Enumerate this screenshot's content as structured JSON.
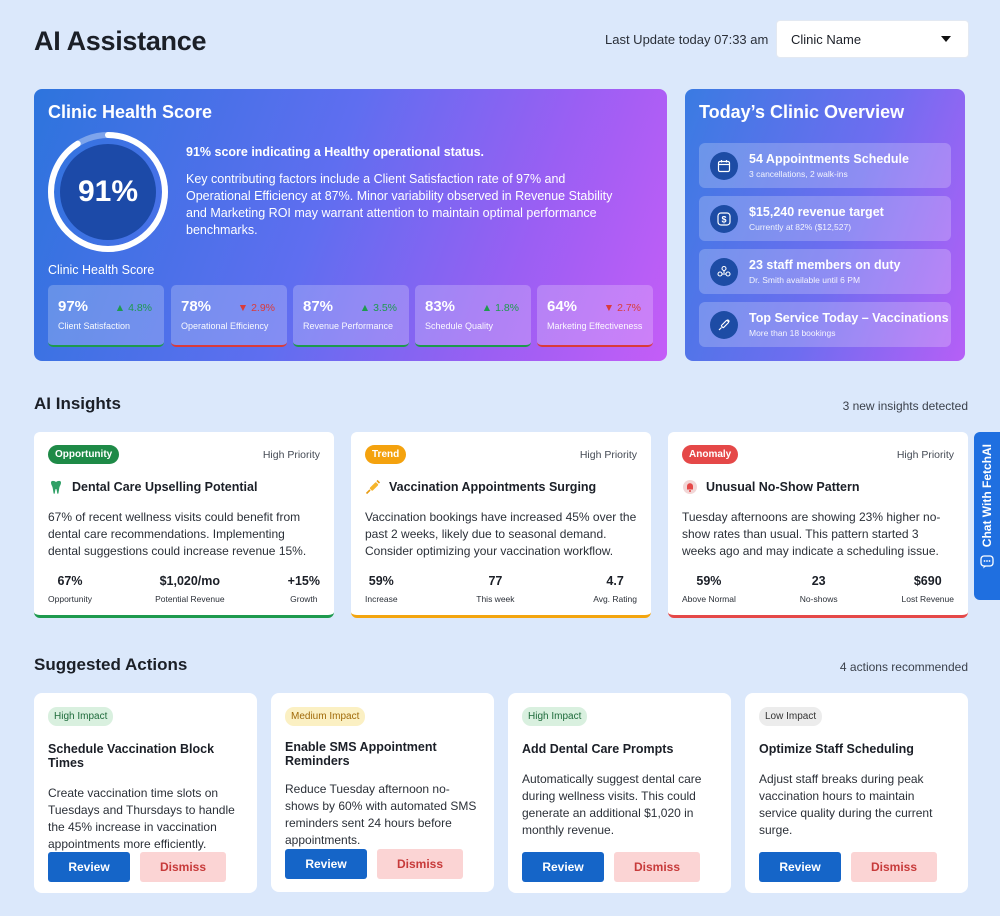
{
  "header": {
    "title": "AI Assistance",
    "last_update": "Last Update today 07:33 am",
    "clinic_select": "Clinic Name"
  },
  "health": {
    "title": "Clinic Health Score",
    "score": "91%",
    "score_fraction": 0.91,
    "headline": "91% score indicating a Healthy operational status.",
    "description": "Key contributing factors include a Client Satisfaction rate of 97% and Operational Efficiency at 87%. Minor variability observed in Revenue Stability and Marketing ROI may warrant attention to maintain optimal performance benchmarks.",
    "subtitle": "Clinic Health Score",
    "metrics": [
      {
        "value": "97%",
        "delta": "4.8%",
        "direction": "up",
        "label": "Client Satisfaction"
      },
      {
        "value": "78%",
        "delta": "2.9%",
        "direction": "down",
        "label": "Operational Efficiency"
      },
      {
        "value": "87%",
        "delta": "3.5%",
        "direction": "up",
        "label": "Revenue Performance"
      },
      {
        "value": "83%",
        "delta": "1.8%",
        "direction": "up",
        "label": "Schedule Quality"
      },
      {
        "value": "64%",
        "delta": "2.7%",
        "direction": "down",
        "label": "Marketing Effectiveness"
      }
    ]
  },
  "overview": {
    "title": "Today’s Clinic Overview",
    "items": [
      {
        "icon": "calendar-icon",
        "main": "54 Appointments Schedule",
        "sub": "3 cancellations, 2 walk-ins"
      },
      {
        "icon": "dollar-icon",
        "main": "$15,240 revenue target",
        "sub": "Currently at 82% ($12,527)"
      },
      {
        "icon": "staff-icon",
        "main": "23 staff members on duty",
        "sub": "Dr. Smith available until 6 PM"
      },
      {
        "icon": "syringe-icon",
        "main": "Top Service Today – Vaccinations",
        "sub": "More than 18 bookings"
      }
    ]
  },
  "insights": {
    "title": "AI Insights",
    "meta": "3 new insights detected",
    "cards": [
      {
        "tag": "Opportunity",
        "priority": "High Priority",
        "icon": "tooth-icon",
        "title": "Dental Care Upselling Potential",
        "body": "67% of recent wellness visits could benefit from dental care recommendations. Implementing dental suggestions could increase revenue    15%.",
        "stats": [
          {
            "value": "67%",
            "label": "Opportunity"
          },
          {
            "value": "$1,020/mo",
            "label": "Potential Revenue"
          },
          {
            "value": "+15%",
            "label": "Growth"
          }
        ]
      },
      {
        "tag": "Trend",
        "priority": "High Priority",
        "icon": "syringe-icon",
        "title": "Vaccination Appointments Surging",
        "body": "Vaccination bookings have increased 45% over the past 2 weeks, likely due to seasonal demand. Consider optimizing your vaccination workflow.",
        "stats": [
          {
            "value": "59%",
            "label": "Increase"
          },
          {
            "value": "77",
            "label": "This week"
          },
          {
            "value": "4.7",
            "label": "Avg. Rating"
          }
        ]
      },
      {
        "tag": "Anomaly",
        "priority": "High Priority",
        "icon": "alert-bell-icon",
        "title": "Unusual No-Show Pattern",
        "body": "Tuesday afternoons are showing 23% higher no-show    rates than usual. This pattern started 3 weeks ago    and may indicate a scheduling issue.",
        "stats": [
          {
            "value": "59%",
            "label": "Above Normal"
          },
          {
            "value": "23",
            "label": "No-shows"
          },
          {
            "value": "$690",
            "label": "Lost Revenue"
          }
        ]
      }
    ]
  },
  "chat": {
    "label": "Chat With FetchAI"
  },
  "actions": {
    "title": "Suggested Actions",
    "meta": "4 actions recommended",
    "review_label": "Review",
    "dismiss_label": "Dismiss",
    "cards": [
      {
        "impact": "High Impact",
        "title": "Schedule Vaccination Block Times",
        "body": "Create vaccination time slots on Tuesdays and Thursdays to handle the 45% increase in vaccination appointments more efficiently."
      },
      {
        "impact": "Medium Impact",
        "title": "Enable SMS Appointment Reminders",
        "body": "Reduce Tuesday afternoon no-shows by 60% with automated SMS reminders sent 24 hours before appointments."
      },
      {
        "impact": "High Impact",
        "title": "Add Dental Care Prompts",
        "body": "Automatically suggest dental care during wellness visits. This could generate an additional $1,020 in monthly revenue."
      },
      {
        "impact": "Low Impact",
        "title": "Optimize Staff Scheduling",
        "body": "Adjust staff breaks during peak vaccination hours to maintain service quality during the current surge."
      }
    ]
  },
  "colors": {
    "accent": "#1565c8",
    "gauge_dark": "#1c4aa8",
    "positive": "#1e9a4e",
    "negative": "#d93b3b",
    "trend": "#f3a50f",
    "anomaly": "#e54848"
  }
}
